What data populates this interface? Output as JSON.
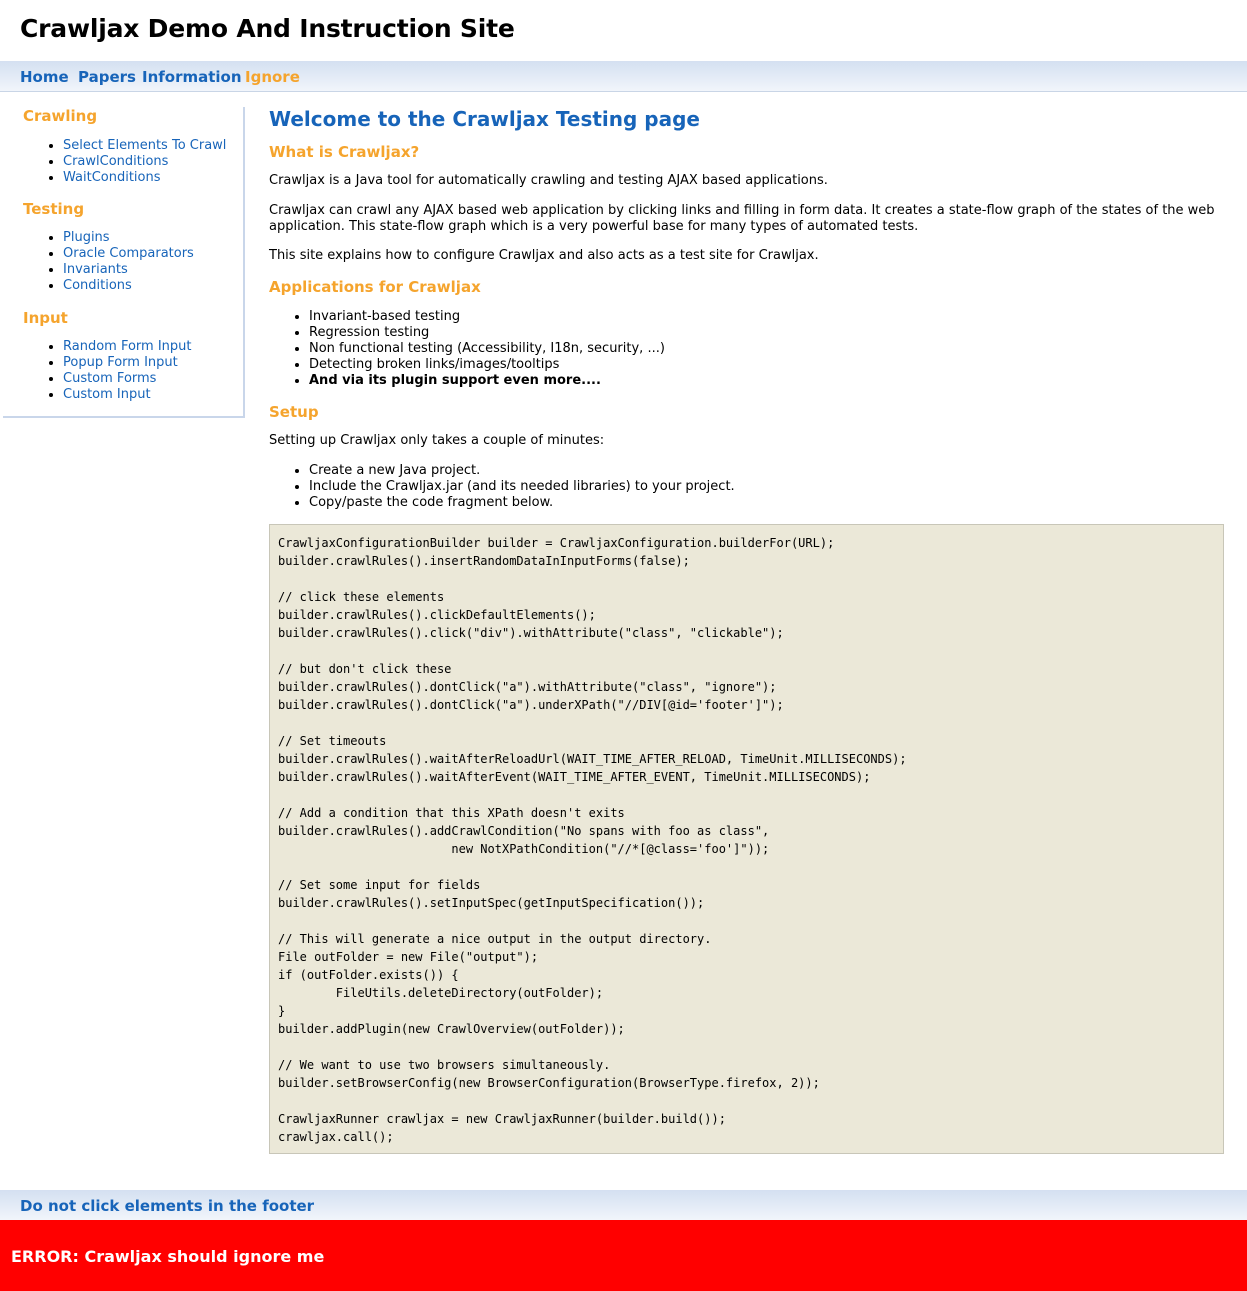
{
  "header": {
    "title": "Crawljax Demo And Instruction Site"
  },
  "nav": {
    "home": "Home",
    "papers": "Papers",
    "information": "Information",
    "ignore": "Ignore"
  },
  "colors": {
    "link_blue": "#1764b9",
    "heading_orange": "#f5a42d",
    "error_red": "#ff0000",
    "code_bg": "#ebe8d8"
  },
  "sidebar": {
    "crawling": {
      "heading": "Crawling",
      "items": [
        "Select Elements To Crawl",
        "CrawlConditions",
        "WaitConditions"
      ]
    },
    "testing": {
      "heading": "Testing",
      "items": [
        "Plugins",
        "Oracle Comparators",
        "Invariants",
        "Conditions"
      ]
    },
    "input": {
      "heading": "Input",
      "items": [
        "Random Form Input",
        "Popup Form Input",
        "Custom Forms",
        "Custom Input"
      ]
    }
  },
  "main": {
    "title": "Welcome to the Crawljax Testing page",
    "what": {
      "heading": "What is Crawljax?",
      "p1": "Crawljax is a Java tool for automatically crawling and testing AJAX based applications.",
      "p2": "Crawljax can crawl any AJAX based web application by clicking links and filling in form data. It creates a state-flow graph of the states of the web application. This state-flow graph which is a very powerful base for many types of automated tests.",
      "p3": "This site explains how to configure Crawljax and also acts as a test site for Crawljax."
    },
    "applications": {
      "heading": "Applications for Crawljax",
      "items": [
        "Invariant-based testing",
        "Regression testing",
        "Non functional testing (Accessibility, I18n, security, ...)",
        "Detecting broken links/images/tooltips",
        "And via its plugin support even more...."
      ]
    },
    "setup": {
      "heading": "Setup",
      "intro": "Setting up Crawljax only takes a couple of minutes:",
      "items": [
        "Create a new Java project.",
        "Include the Crawljax.jar (and its needed libraries) to your project.",
        "Copy/paste the code fragment below."
      ]
    },
    "code": "CrawljaxConfigurationBuilder builder = CrawljaxConfiguration.builderFor(URL);\nbuilder.crawlRules().insertRandomDataInInputForms(false);\n\n// click these elements\nbuilder.crawlRules().clickDefaultElements();\nbuilder.crawlRules().click(\"div\").withAttribute(\"class\", \"clickable\");\n\n// but don't click these\nbuilder.crawlRules().dontClick(\"a\").withAttribute(\"class\", \"ignore\");\nbuilder.crawlRules().dontClick(\"a\").underXPath(\"//DIV[@id='footer']\");\n\n// Set timeouts\nbuilder.crawlRules().waitAfterReloadUrl(WAIT_TIME_AFTER_RELOAD, TimeUnit.MILLISECONDS);\nbuilder.crawlRules().waitAfterEvent(WAIT_TIME_AFTER_EVENT, TimeUnit.MILLISECONDS);\n\n// Add a condition that this XPath doesn't exits\nbuilder.crawlRules().addCrawlCondition(\"No spans with foo as class\",\n                        new NotXPathCondition(\"//*[@class='foo']\"));\n\n// Set some input for fields\nbuilder.crawlRules().setInputSpec(getInputSpecification());\n\n// This will generate a nice output in the output directory.\nFile outFolder = new File(\"output\");\nif (outFolder.exists()) {\n        FileUtils.deleteDirectory(outFolder);\n}\nbuilder.addPlugin(new CrawlOverview(outFolder));\n\n// We want to use two browsers simultaneously.\nbuilder.setBrowserConfig(new BrowserConfiguration(BrowserType.firefox, 2));\n\nCrawljaxRunner crawljax = new CrawljaxRunner(builder.build());\ncrawljax.call();"
  },
  "footer": {
    "link": "Do not click elements in the footer",
    "error": "ERROR: Crawljax should ignore me"
  }
}
